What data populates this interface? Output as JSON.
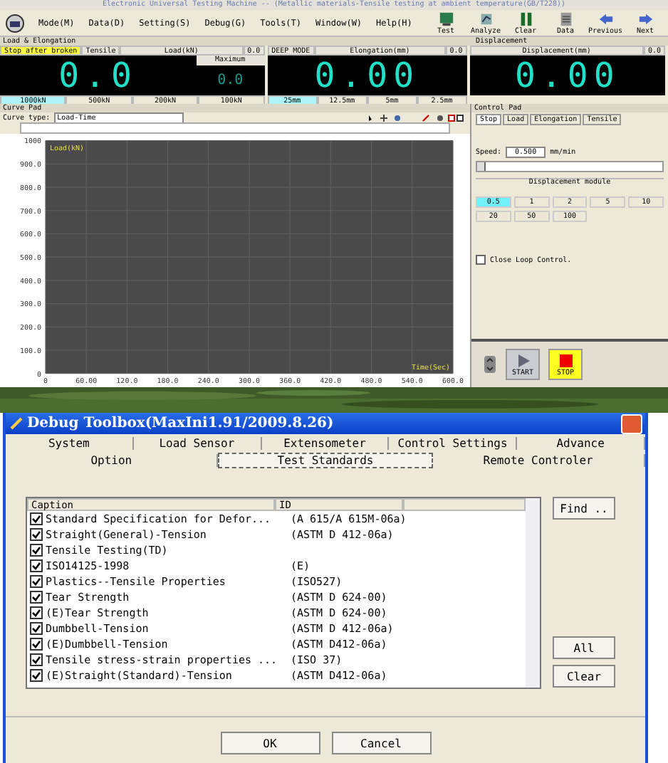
{
  "app": {
    "title": "Electronic Universal Testing Machine -- (Metallic materials-Tensile testing at ambient temperature(GB/T228))",
    "menu": [
      "Mode(M)",
      "Data(D)",
      "Setting(S)",
      "Debug(G)",
      "Tools(T)",
      "Window(W)",
      "Help(H)"
    ],
    "toolbar": [
      {
        "label": "Test",
        "kind": "test"
      },
      {
        "label": "Analyze",
        "kind": "analyze"
      },
      {
        "label": "Clear",
        "kind": "clear"
      },
      {
        "label": "Data",
        "kind": "data"
      },
      {
        "label": "Previous",
        "kind": "previous"
      },
      {
        "label": "Next",
        "kind": "next"
      }
    ],
    "load_section": "Load & Elongation",
    "displacement_section": "Displacement",
    "panels": [
      {
        "kind": "load",
        "badge": "Stop after broken",
        "mode": "Tensile",
        "caption": "Load(kN)",
        "small": "0.0",
        "value": "0.0",
        "max_label": "Maximum",
        "max_value": "0.0",
        "ranges": [
          {
            "label": "1000kN",
            "selected": true
          },
          {
            "label": "500kN",
            "selected": false
          },
          {
            "label": "200kN",
            "selected": false
          },
          {
            "label": "100kN",
            "selected": false
          }
        ]
      },
      {
        "kind": "elongation",
        "mode": "DEEP MODE",
        "caption": "Elongation(mm)",
        "small": "0.0",
        "value": "0.00",
        "ranges": [
          {
            "label": "25mm",
            "selected": true
          },
          {
            "label": "12.5mm",
            "selected": false
          },
          {
            "label": "5mm",
            "selected": false
          },
          {
            "label": "2.5mm",
            "selected": false
          }
        ]
      },
      {
        "kind": "displacement",
        "caption": "Displacement(mm)",
        "small": "0.0",
        "value": "0.00"
      }
    ],
    "curve_pad": {
      "title": "Curve Pad",
      "type_label": "Curve type:",
      "type_value": "Load-Time",
      "chart": {
        "y_label": "Load(kN)",
        "x_label": "Time(Sec)",
        "y_ticks": [
          "1000",
          "900.0",
          "800.0",
          "700.0",
          "600.0",
          "500.0",
          "400.0",
          "300.0",
          "200.0",
          "100.0",
          "0"
        ],
        "x_ticks": [
          "0",
          "60.00",
          "120.0",
          "180.0",
          "240.0",
          "300.0",
          "360.0",
          "420.0",
          "480.0",
          "540.0",
          "600.0"
        ]
      }
    },
    "control_pad": {
      "title": "Control Pad",
      "tabs": [
        {
          "label": "Stop",
          "selected": true
        },
        {
          "label": "Load",
          "selected": false
        },
        {
          "label": "Elongation",
          "selected": false
        },
        {
          "label": "Tensile",
          "selected": false
        }
      ],
      "speed_label": "Speed:",
      "speed_value": "0.500",
      "speed_unit": "mm/min",
      "speed_slider": {
        "level": 0
      },
      "group": "Displacement module",
      "rates": [
        {
          "label": "0.5",
          "selected": true
        },
        {
          "label": "1",
          "selected": false
        },
        {
          "label": "2",
          "selected": false
        },
        {
          "label": "5",
          "selected": false
        },
        {
          "label": "10",
          "selected": false
        },
        {
          "label": "20",
          "selected": false
        },
        {
          "label": "50",
          "selected": false
        },
        {
          "label": "100",
          "selected": false
        }
      ],
      "close_loop": {
        "label": "Close Loop Control.",
        "checked": false
      },
      "start": "START",
      "stop": "STOP"
    }
  },
  "dialog": {
    "title": "Debug Toolbox(MaxIni1.91/2009.8.26)",
    "tabs_row1": [
      {
        "label": "System",
        "selected": false
      },
      {
        "label": "Load Sensor",
        "selected": false
      },
      {
        "label": "Extensometer",
        "selected": false
      },
      {
        "label": "Control Settings",
        "selected": false
      },
      {
        "label": "Advance",
        "selected": false
      }
    ],
    "tabs_row2": [
      {
        "label": "Option",
        "selected": false
      },
      {
        "label": "Test Standards",
        "selected": true
      },
      {
        "label": "Remote Controler",
        "selected": false
      }
    ],
    "columns": [
      "Caption",
      "ID"
    ],
    "rows": [
      {
        "caption": "Standard Specification for Defor...",
        "id": "(A 615/A 615M-06a)",
        "checked": true
      },
      {
        "caption": "Straight(General)-Tension",
        "id": "(ASTM D 412-06a)",
        "checked": true
      },
      {
        "caption": "Tensile Testing(TD)",
        "id": "",
        "checked": true
      },
      {
        "caption": "ISO14125-1998",
        "id": "(E)",
        "checked": true
      },
      {
        "caption": "Plastics--Tensile Properties",
        "id": "(ISO527)",
        "checked": true
      },
      {
        "caption": "Tear Strength",
        "id": "(ASTM D 624-00)",
        "checked": true
      },
      {
        "caption": "(E)Tear Strength",
        "id": "(ASTM D 624-00)",
        "checked": true
      },
      {
        "caption": "Dumbbell-Tension",
        "id": "(ASTM D 412-06a)",
        "checked": true
      },
      {
        "caption": "(E)Dumbbell-Tension",
        "id": "(ASTM D412-06a)",
        "checked": true
      },
      {
        "caption": "Tensile stress-strain properties ...",
        "id": "(ISO 37)",
        "checked": true
      },
      {
        "caption": "(E)Straight(Standard)-Tension",
        "id": "(ASTM D412-06a)",
        "checked": true
      }
    ],
    "side_buttons": [
      "Find ..",
      "All",
      "Clear"
    ],
    "buttons": [
      "OK",
      "Cancel"
    ]
  }
}
